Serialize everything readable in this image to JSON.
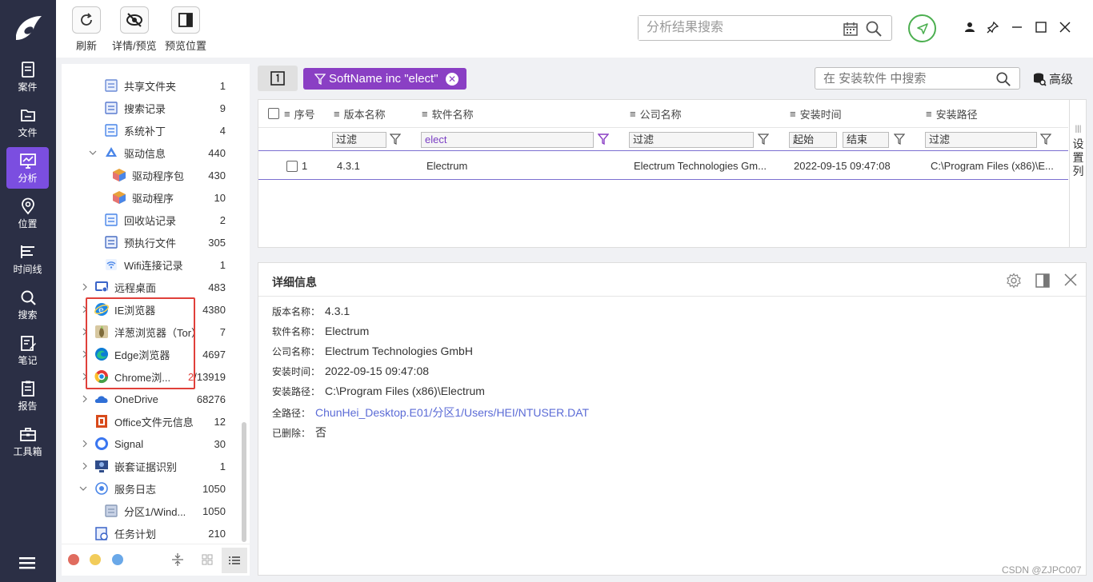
{
  "nav": {
    "items": [
      {
        "label": "案件",
        "icon": "case-icon"
      },
      {
        "label": "文件",
        "icon": "folder-icon"
      },
      {
        "label": "分析",
        "icon": "analysis-icon"
      },
      {
        "label": "位置",
        "icon": "location-icon"
      },
      {
        "label": "时间线",
        "icon": "timeline-icon"
      },
      {
        "label": "搜索",
        "icon": "search-icon"
      },
      {
        "label": "笔记",
        "icon": "notes-icon"
      },
      {
        "label": "报告",
        "icon": "report-icon"
      },
      {
        "label": "工具箱",
        "icon": "toolbox-icon"
      }
    ],
    "active_index": 2,
    "accent": "#7b4ee0",
    "bg": "#2b2f45"
  },
  "toolbar": {
    "refresh_label": "刷新",
    "detail_label": "详情/预览",
    "preview_pos_label": "预览位置",
    "search_placeholder": "分析结果搜索"
  },
  "tree": [
    {
      "label": "共享文件夹",
      "count": "1",
      "indent": 2,
      "icon": "shared-folder-icon"
    },
    {
      "label": "搜索记录",
      "count": "9",
      "indent": 2,
      "icon": "search-record-icon"
    },
    {
      "label": "系统补丁",
      "count": "4",
      "indent": 2,
      "icon": "patch-icon"
    },
    {
      "label": "驱动信息",
      "count": "440",
      "indent": 2,
      "icon": "driver-icon",
      "expanded": true
    },
    {
      "label": "驱动程序包",
      "count": "430",
      "indent": 3,
      "icon": "package-icon"
    },
    {
      "label": "驱动程序",
      "count": "10",
      "indent": 3,
      "icon": "package-icon"
    },
    {
      "label": "回收站记录",
      "count": "2",
      "indent": 2,
      "icon": "recycle-icon"
    },
    {
      "label": "预执行文件",
      "count": "305",
      "indent": 2,
      "icon": "prefetch-icon"
    },
    {
      "label": "Wifi连接记录",
      "count": "1",
      "indent": 2,
      "icon": "wifi-icon"
    },
    {
      "label": "远程桌面",
      "count": "483",
      "indent": 1,
      "icon": "remote-desktop-icon",
      "collapsed": true
    },
    {
      "label": "IE浏览器",
      "count": "4380",
      "indent": 1,
      "icon": "ie-icon",
      "collapsed": true
    },
    {
      "label": "洋葱浏览器（Tor）",
      "count": "7",
      "indent": 1,
      "icon": "tor-icon",
      "collapsed": true
    },
    {
      "label": "Edge浏览器",
      "count": "4697",
      "indent": 1,
      "icon": "edge-icon",
      "collapsed": true
    },
    {
      "label": "Chrome浏...",
      "count": "2/13919",
      "indent": 1,
      "icon": "chrome-icon",
      "collapsed": true,
      "count_red": "2"
    },
    {
      "label": "OneDrive",
      "count": "68276",
      "indent": 1,
      "icon": "onedrive-icon",
      "collapsed": true
    },
    {
      "label": "Office文件元信息",
      "count": "12",
      "indent": 1,
      "icon": "office-icon"
    },
    {
      "label": "Signal",
      "count": "30",
      "indent": 1,
      "icon": "signal-icon",
      "collapsed": true
    },
    {
      "label": "嵌套证据识别",
      "count": "1",
      "indent": 1,
      "icon": "nested-evidence-icon",
      "collapsed": true
    },
    {
      "label": "服务日志",
      "count": "1050",
      "indent": 1,
      "icon": "service-log-icon",
      "expanded": true
    },
    {
      "label": "分区1/Wind...",
      "count": "1050",
      "indent": 2,
      "icon": "partition-icon"
    },
    {
      "label": "任务计划",
      "count": "210",
      "indent": 1,
      "icon": "task-icon"
    }
  ],
  "filter_chip": "SoftName inc \"elect\"",
  "table_search_placeholder": "在 安装软件 中搜索",
  "advanced_label": "高级",
  "table": {
    "columns": [
      "序号",
      "版本名称",
      "软件名称",
      "公司名称",
      "安装时间",
      "安装路径"
    ],
    "filters": {
      "version": "过滤",
      "software": "elect",
      "company": "过滤",
      "start": "起始",
      "end": "结束",
      "path": "过滤"
    },
    "rows": [
      [
        "1",
        "4.3.1",
        "Electrum",
        "Electrum Technologies Gm...",
        "2022-09-15 09:47:08",
        "C:\\Program Files (x86)\\E..."
      ]
    ],
    "side_label": [
      "设",
      "置",
      "列"
    ]
  },
  "detail": {
    "title": "详细信息",
    "fields": [
      {
        "k": "版本名称：",
        "v": "4.3.1"
      },
      {
        "k": "软件名称：",
        "v": "Electrum"
      },
      {
        "k": "公司名称：",
        "v": "Electrum Technologies GmbH"
      },
      {
        "k": "安装时间：",
        "v": "2022-09-15 09:47:08"
      },
      {
        "k": "安装路径：",
        "v": "C:\\Program Files (x86)\\Electrum"
      },
      {
        "k": "全路径：",
        "v": "ChunHei_Desktop.E01/分区1/Users/HEI/NTUSER.DAT",
        "link": true
      },
      {
        "k": "已删除：",
        "v": "否"
      }
    ]
  },
  "watermark": "CSDN @ZJPC007"
}
